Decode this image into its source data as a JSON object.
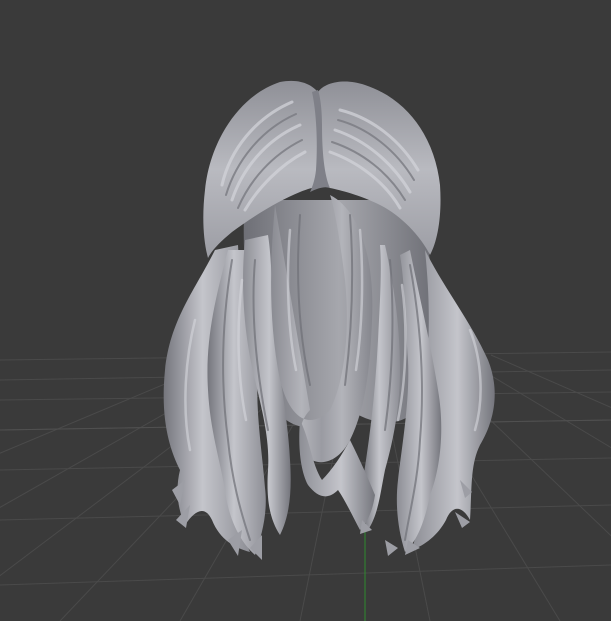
{
  "viewport": {
    "background_color": "#3a3a3a",
    "grid_color": "#4a4a4a",
    "grid_color_strong": "#505050",
    "axis_color": "#2f8a2f"
  },
  "model": {
    "object_name": "hair-mesh",
    "base_color": "#a9aab0",
    "shadow_color": "#7f8088",
    "deep_shadow_color": "#5f6068",
    "highlight_color": "#d9dae0"
  }
}
